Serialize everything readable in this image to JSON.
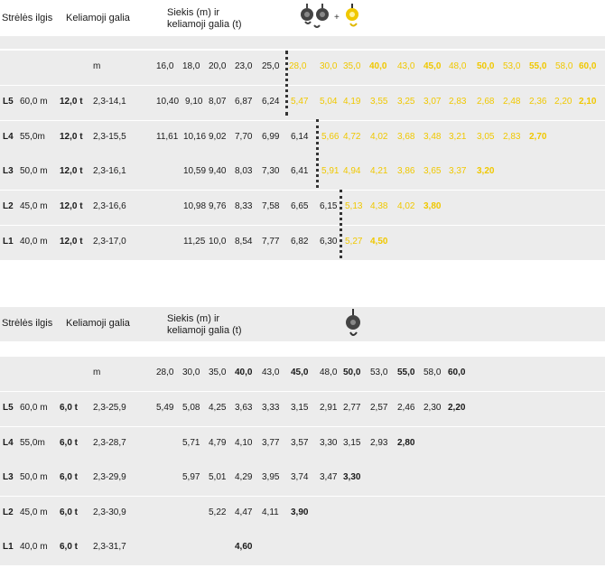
{
  "table1": {
    "header": {
      "col1": "Strėlės ilgis",
      "col2": "Keliamoji galia",
      "col3_line1": "Siekis (m) ir",
      "col3_line2": "keliamoji galia (t)",
      "icon_plus": "+"
    },
    "unit_label": "m",
    "reach_black": [
      "16,0",
      "18,0",
      "20,0",
      "23,0",
      "25,0"
    ],
    "reach_yellow": [
      "28,0",
      "30,0",
      "35,0",
      "40,0",
      "43,0",
      "45,0",
      "48,0",
      "50,0",
      "53,0",
      "55,0",
      "58,0",
      "60,0"
    ],
    "rows": [
      {
        "code": "L5",
        "length": "60,0 m",
        "load": "12,0 t",
        "range": "2,3-14,1",
        "black": [
          "10,40",
          "9,10",
          "8,07",
          "6,87",
          "6,24"
        ],
        "yellow": [
          "5,47",
          "5,04",
          "4,19",
          "3,55",
          "3,25",
          "3,07",
          "2,83",
          "2,68",
          "2,48",
          "2,36",
          "2,20",
          "2,10"
        ]
      },
      {
        "code": "L4",
        "length": "55,0m",
        "load": "12,0 t",
        "range": "2,3-15,5",
        "black": [
          "11,61",
          "10,16",
          "9,02",
          "7,70",
          "6,99",
          "6,14"
        ],
        "yellow": [
          "5,66",
          "4,72",
          "4,02",
          "3,68",
          "3,48",
          "3,21",
          "3,05",
          "2,83",
          "2,70"
        ]
      },
      {
        "code": "L3",
        "length": "50,0 m",
        "load": "12,0 t",
        "range": "2,3-16,1",
        "black": [
          "10,59",
          "9,40",
          "8,03",
          "7,30",
          "6,41"
        ],
        "yellow": [
          "5,91",
          "4,94",
          "4,21",
          "3,86",
          "3,65",
          "3,37",
          "3,20"
        ]
      },
      {
        "code": "L2",
        "length": "45,0 m",
        "load": "12,0 t",
        "range": "2,3-16,6",
        "black": [
          "10,98",
          "9,76",
          "8,33",
          "7,58",
          "6,65",
          "6,15"
        ],
        "yellow": [
          "5,13",
          "4,38",
          "4,02",
          "3,80"
        ]
      },
      {
        "code": "L1",
        "length": "40,0 m",
        "load": "12,0 t",
        "range": "2,3-17,0",
        "black": [
          "11,25",
          "10,0",
          "8,54",
          "7,77",
          "6,82",
          "6,30"
        ],
        "yellow": [
          "5,27",
          "4,50"
        ]
      }
    ]
  },
  "table2": {
    "header": {
      "col1": "Strėlės ilgis",
      "col2": "Keliamoji galia",
      "col3_line1": "Siekis (m) ir",
      "col3_line2": "keliamoji galia (t)"
    },
    "unit_label": "m",
    "reach": [
      "28,0",
      "30,0",
      "35,0",
      "40,0",
      "43,0",
      "45,0",
      "48,0",
      "50,0",
      "53,0",
      "55,0",
      "58,0",
      "60,0"
    ],
    "rows": [
      {
        "code": "L5",
        "length": "60,0 m",
        "load": "6,0 t",
        "range": "2,3-25,9",
        "values": [
          "5,49",
          "5,08",
          "4,25",
          "3,63",
          "3,33",
          "3,15",
          "2,91",
          "2,77",
          "2,57",
          "2,46",
          "2,30",
          "2,20"
        ]
      },
      {
        "code": "L4",
        "length": "55,0m",
        "load": "6,0 t",
        "range": "2,3-28,7",
        "values": [
          "5,71",
          "4,79",
          "4,10",
          "3,77",
          "3,57",
          "3,30",
          "3,15",
          "2,93",
          "2,80"
        ]
      },
      {
        "code": "L3",
        "length": "50,0 m",
        "load": "6,0 t",
        "range": "2,3-29,9",
        "values": [
          "5,97",
          "5,01",
          "4,29",
          "3,95",
          "3,74",
          "3,47",
          "3,30"
        ]
      },
      {
        "code": "L2",
        "length": "45,0 m",
        "load": "6,0 t",
        "range": "2,3-30,9",
        "values": [
          "5,22",
          "4,47",
          "4,11",
          "3,90"
        ]
      },
      {
        "code": "L1",
        "length": "40,0 m",
        "load": "6,0 t",
        "range": "2,3-31,7",
        "values": [
          "4,60"
        ]
      }
    ]
  },
  "colors": {
    "band": "#ececec",
    "accent_yellow": "#f0c800",
    "hook_dark": "#444444"
  },
  "icons": {
    "table1": [
      "pulley-hook-icon",
      "pulley-hook-icon",
      "hook-yellow-icon"
    ],
    "table2": [
      "pulley-hook-icon"
    ]
  }
}
